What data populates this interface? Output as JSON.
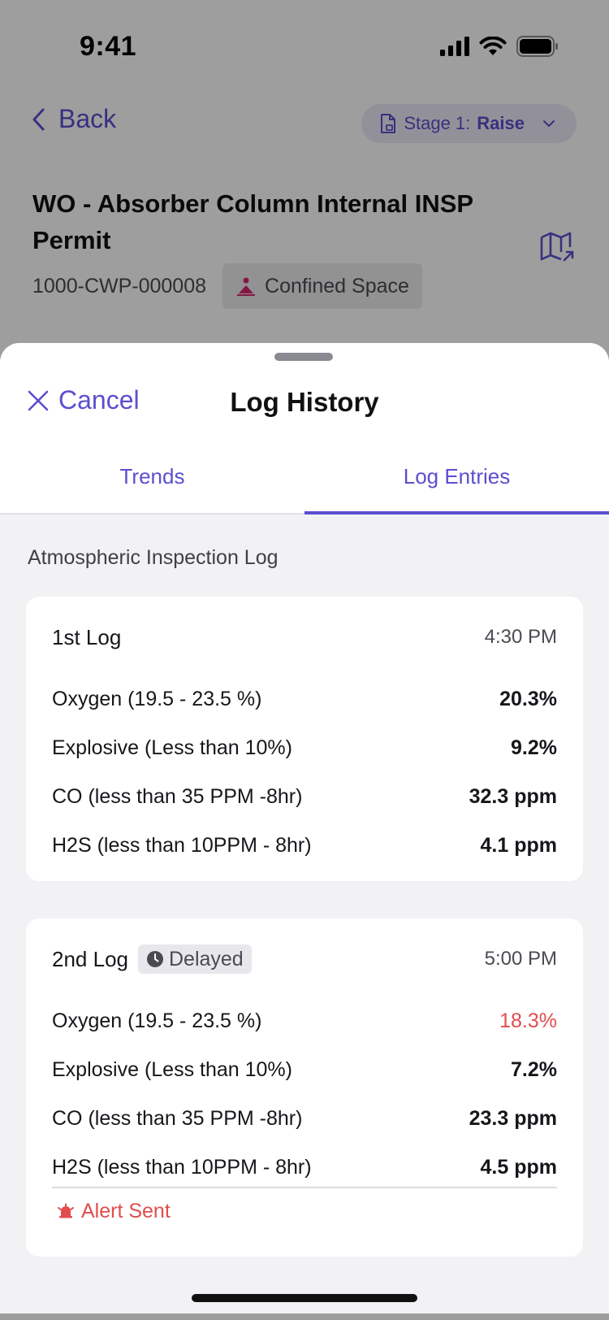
{
  "status_bar": {
    "time": "9:41"
  },
  "nav": {
    "back_label": "Back",
    "stage_prefix": "Stage 1:",
    "stage_value": "Raise"
  },
  "work_order": {
    "title": "WO - Absorber Column Internal INSP Permit",
    "permit_id": "1000-CWP-000008",
    "space_type": "Confined Space"
  },
  "sheet": {
    "cancel_label": "Cancel",
    "title": "Log History",
    "tabs": [
      {
        "label": "Trends",
        "active": false
      },
      {
        "label": "Log Entries",
        "active": true
      }
    ],
    "section_title": "Atmospheric Inspection Log"
  },
  "logs": [
    {
      "name": "1st Log",
      "time": "4:30 PM",
      "rows": [
        {
          "label": "Oxygen (19.5 - 23.5 %)",
          "value": "20.3%"
        },
        {
          "label": "Explosive (Less than 10%)",
          "value": "9.2%"
        },
        {
          "label": "CO (less than 35 PPM -8hr)",
          "value": "32.3 ppm"
        },
        {
          "label": "H2S (less than 10PPM - 8hr)",
          "value": "4.1 ppm"
        }
      ]
    },
    {
      "name": "2nd Log",
      "badge": "Delayed",
      "time": "5:00 PM",
      "rows": [
        {
          "label": "Oxygen (19.5 - 23.5 %)",
          "value": "18.3%"
        },
        {
          "label": "Explosive (Less than 10%)",
          "value": "7.2%"
        },
        {
          "label": "CO (less than 35 PPM -8hr)",
          "value": "23.3 ppm"
        },
        {
          "label": "H2S (less than 10PPM - 8hr)",
          "value": "4.5 ppm"
        }
      ],
      "alert": "Alert Sent"
    }
  ],
  "colors": {
    "accent": "#5a4fcf",
    "alert": "#e14d4d",
    "sheet_bg": "#f2f2f4"
  }
}
